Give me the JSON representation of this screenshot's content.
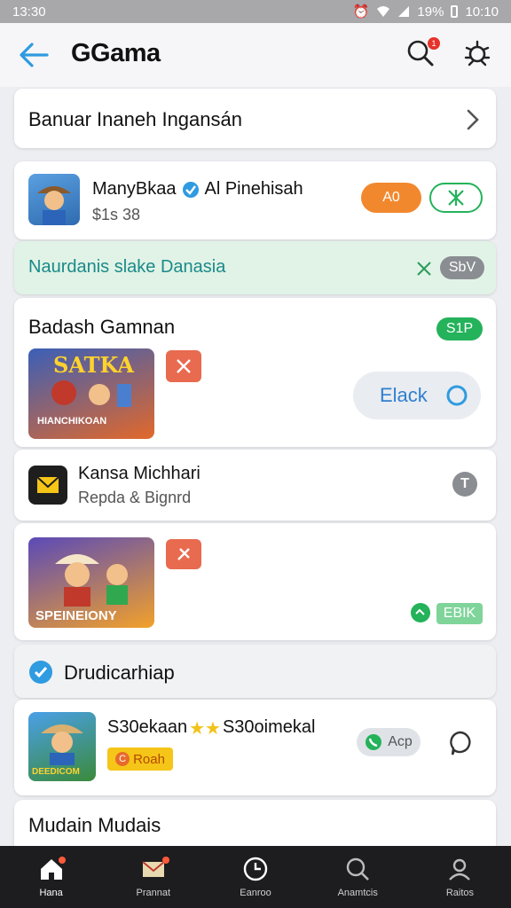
{
  "status": {
    "time": "13:30",
    "battery": "19%",
    "clock": "10:10"
  },
  "header": {
    "title": "GGama",
    "notif_count": "1"
  },
  "banner": {
    "text": "Banuar Inaneh Ingansán"
  },
  "app_row": {
    "name": "ManyBkaa",
    "dev": "Al Pinehisah",
    "price": "$1s 38",
    "btn_label": "A0"
  },
  "promo": {
    "text": "Naurdanis slake Danasia",
    "pill": "SbV"
  },
  "section1": {
    "title": "Badash Gamnan",
    "tag": "S1P",
    "game_title_top": "SATKA",
    "game_title_bottom": "HIANCHIKOAN",
    "action": "Elack"
  },
  "list_item": {
    "title": "Kansa Michhari",
    "subtitle": "Repda & Bignrd",
    "info": "T"
  },
  "game2": {
    "title": "SPEINEIONY",
    "action": "EBIK"
  },
  "section2": {
    "title": "Drudicarhiap"
  },
  "app2": {
    "name": "S30ekaan",
    "stars": "★★",
    "name2": "S30oimekal",
    "tag": "Roah",
    "tag_icon": "C",
    "call": "Acp",
    "thumb_text": "DEEDICOM"
  },
  "section3": {
    "title": "Mudain Mudais"
  },
  "nav": {
    "items": [
      "Hana",
      "Prannat",
      "Eanroo",
      "Anamtcis",
      "Raitos"
    ]
  },
  "colors": {
    "accent_blue": "#2f9be0",
    "orange": "#f2882e",
    "green": "#24b25a",
    "red": "#e86a4f"
  }
}
